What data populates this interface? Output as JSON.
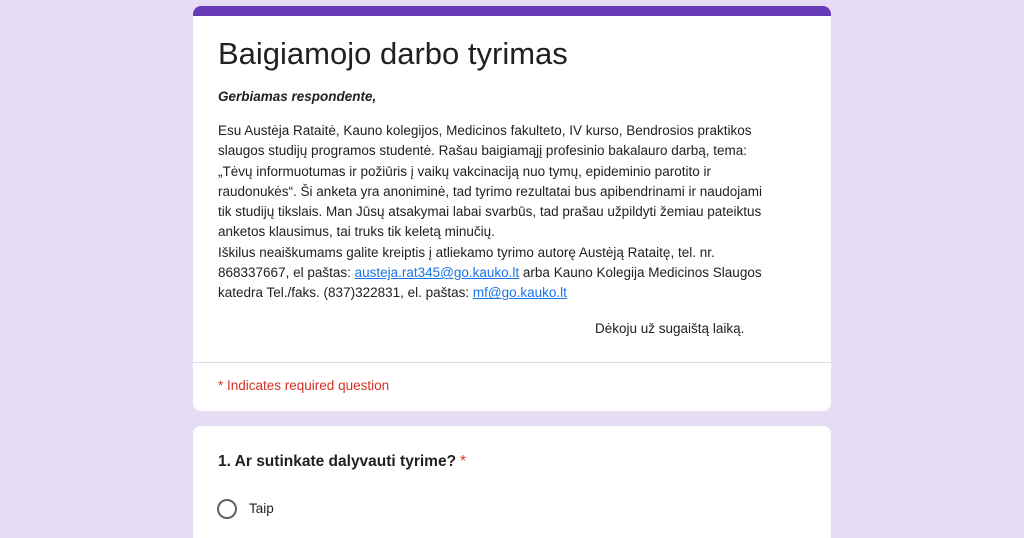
{
  "form": {
    "title": "Baigiamojo darbo tyrimas",
    "salutation": "Gerbiamas respondente,",
    "intro_lines": [
      "Esu Austėja Rataitė, Kauno kolegijos, Medicinos fakulteto, IV kurso, Bendrosios praktikos",
      "slaugos studijų programos studentė. Rašau baigiamąjį profesinio bakalauro darbą, tema:",
      "„Tėvų informuotumas ir požiūris į vaikų vakcinaciją nuo tymų, epideminio parotito ir",
      "raudonukės“. Ši anketa yra anoniminė, tad tyrimo rezultatai bus apibendrinami ir naudojami",
      "tik studijų tikslais. Man Jūsų atsakymai labai svarbūs, tad prašau užpildyti žemiau pateiktus",
      "anketos klausimus, tai truks tik keletą minučių.",
      "Iškilus neaiškumams galite kreiptis į atliekamo tyrimo autorę Austėją Rataitę, tel. nr."
    ],
    "contact_line_1_prefix": "868337667, el paštas: ",
    "contact_email_1": "austeja.rat345@go.kauko.lt",
    "contact_line_1_suffix": " arba Kauno Kolegija Medicinos Slaugos",
    "contact_line_2_prefix": "katedra Tel./faks. (837)322831, el. paštas: ",
    "contact_email_2": "mf@go.kauko.lt",
    "thanks": "Dėkoju už sugaištą laiką.",
    "required_note": "* Indicates required question"
  },
  "question1": {
    "title": "1. Ar sutinkate dalyvauti tyrime?",
    "required_marker": "*",
    "options": [
      "Taip"
    ]
  },
  "colors": {
    "accent": "#673ab7",
    "background": "#e6dcf3",
    "required": "#d93025",
    "link": "#1a73e8"
  }
}
